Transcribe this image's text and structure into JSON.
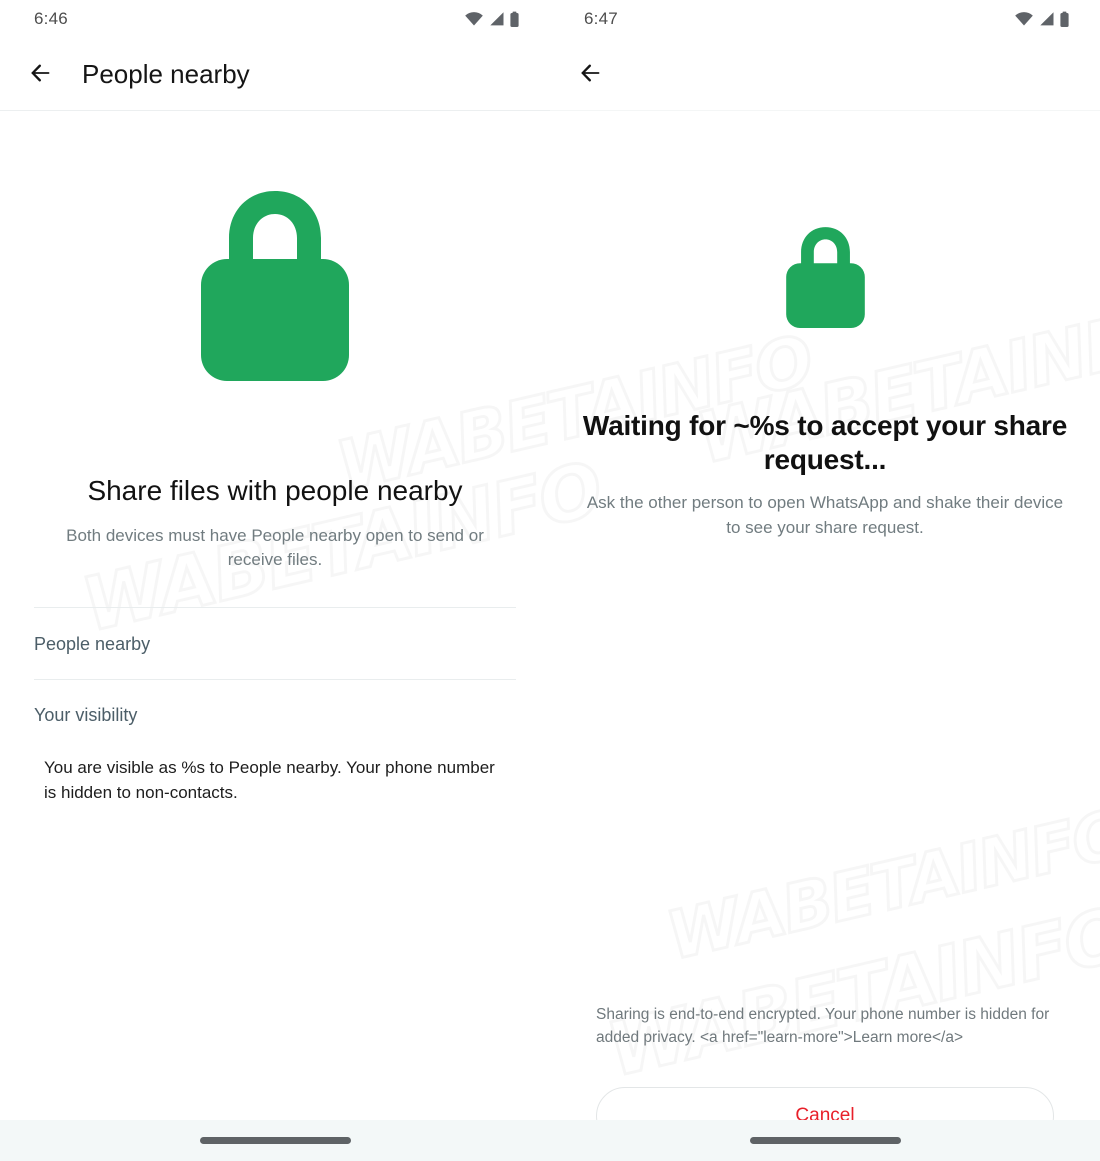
{
  "meta": {
    "app": "WhatsApp",
    "accent_green": "#20a75c",
    "slate_label": "#4c5e68",
    "cancel_red": "#e8202a",
    "nav_bar_bg": "#f3f8f8",
    "watermark_text": "WABETAINFO"
  },
  "left_panel": {
    "status_bar": {
      "time": "6:46",
      "icons": [
        "wifi-icon",
        "cellular-signal-icon",
        "battery-icon"
      ]
    },
    "app_bar": {
      "back_icon": "back-arrow-icon",
      "title": "People nearby"
    },
    "hero": {
      "lock_icon": "lock-icon",
      "title": "Share files with people nearby",
      "subtitle": "Both devices must have People nearby open to send or receive files."
    },
    "sections": [
      {
        "label": "People nearby"
      },
      {
        "label": "Your visibility"
      }
    ],
    "visibility_body": "You are visible as %s to People nearby. Your phone number is hidden to non-contacts."
  },
  "right_panel": {
    "status_bar": {
      "time": "6:47",
      "icons": [
        "wifi-icon",
        "cellular-signal-icon",
        "battery-icon"
      ]
    },
    "app_bar": {
      "back_icon": "back-arrow-icon",
      "title": ""
    },
    "hero": {
      "lock_icon": "lock-icon",
      "title": "Waiting for ~%s to accept your share request...",
      "subtitle": "Ask the other person to open WhatsApp and shake their device to see your share request."
    },
    "footer": {
      "note": "Sharing is end-to-end encrypted. Your phone number is hidden for added privacy. <a href=\"learn-more\">Learn more</a>",
      "cancel_label": "Cancel"
    }
  },
  "watermarks": {
    "w1": "WABETAINFO",
    "w2": "WABETAINFO",
    "w3": "WABETAINFO",
    "w4": "WABETAINFO",
    "w5": "WABETAINFO"
  }
}
